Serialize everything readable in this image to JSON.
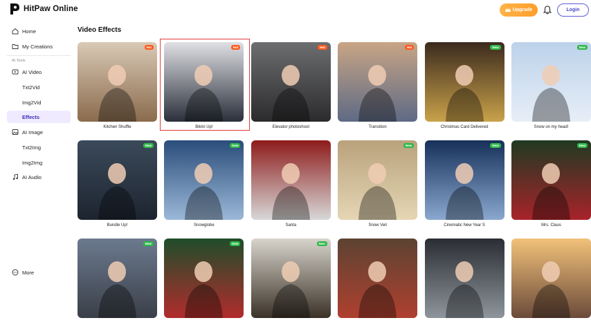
{
  "app": {
    "name": "HitPaw Online"
  },
  "header": {
    "upgrade_label": "Upgrade",
    "login_label": "Login",
    "bell_icon": "bell-icon",
    "crown_icon": "crown-icon"
  },
  "sidebar": {
    "home": "Home",
    "my_creations": "My Creations",
    "section_label": "AI Tools",
    "ai_video": "AI Video",
    "txt2vid": "Txt2Vid",
    "img2vid": "Img2Vid",
    "effects": "Effects",
    "ai_image": "AI Image",
    "txt2img": "Txt2Img",
    "img2img": "Img2Img",
    "ai_audio": "AI Audio",
    "more": "More"
  },
  "main": {
    "title": "Video Effects",
    "cards": [
      {
        "label": "Kitchen Shuffle",
        "badge": "Hot",
        "colors": [
          "#d9c9b5",
          "#8a6b4d"
        ]
      },
      {
        "label": "Bikini Up!",
        "badge": "Hot",
        "colors": [
          "#dfe0e4",
          "#2a2f3a"
        ]
      },
      {
        "label": "Elevator photoshoot",
        "badge": "Hot",
        "colors": [
          "#6d6e70",
          "#2b2b2d"
        ]
      },
      {
        "label": "Transition",
        "badge": "Hot",
        "colors": [
          "#c8a585",
          "#5e6a85"
        ]
      },
      {
        "label": "Christmas Card Delivered",
        "badge": "New",
        "colors": [
          "#3b2a1e",
          "#c9a24a"
        ]
      },
      {
        "label": "Snow on my head!",
        "badge": "New",
        "colors": [
          "#bcd2ea",
          "#e7eef7"
        ]
      },
      {
        "label": "Bundle Up!",
        "badge": "New",
        "colors": [
          "#3b4a5a",
          "#1d2430"
        ]
      },
      {
        "label": "Snowglobe",
        "badge": "New",
        "colors": [
          "#2a4d7a",
          "#9bb8d8"
        ]
      },
      {
        "label": "Santa",
        "badge": "",
        "colors": [
          "#8e1b1b",
          "#d8d8d8"
        ]
      },
      {
        "label": "Snow Veil",
        "badge": "New",
        "colors": [
          "#b9a27c",
          "#e5d6b4"
        ]
      },
      {
        "label": "Cinematic New Year S",
        "badge": "New",
        "colors": [
          "#16305a",
          "#8aa8cf"
        ]
      },
      {
        "label": "Mrs. Claus",
        "badge": "New",
        "colors": [
          "#1f3a22",
          "#a8232a"
        ]
      },
      {
        "label": "",
        "badge": "New",
        "colors": [
          "#6c7a8f",
          "#3a3f48"
        ]
      },
      {
        "label": "",
        "badge": "New",
        "colors": [
          "#1f4d2a",
          "#b22c2c"
        ]
      },
      {
        "label": "",
        "badge": "New",
        "colors": [
          "#d8d4cc",
          "#3a3227"
        ]
      },
      {
        "label": "",
        "badge": "",
        "colors": [
          "#5c4332",
          "#b04030"
        ]
      },
      {
        "label": "",
        "badge": "",
        "colors": [
          "#2a2d33",
          "#8e959c"
        ]
      },
      {
        "label": "",
        "badge": "",
        "colors": [
          "#f2c27a",
          "#6b4a3a"
        ]
      }
    ]
  }
}
